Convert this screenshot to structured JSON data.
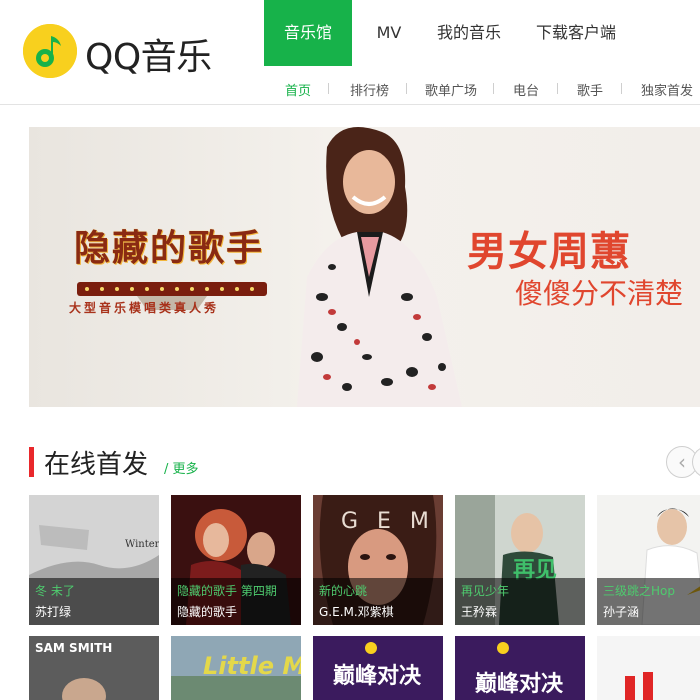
{
  "brand": {
    "name": "QQ音乐"
  },
  "topnav": [
    {
      "label": "音乐馆",
      "active": true
    },
    {
      "label": "MV"
    },
    {
      "label": "我的音乐"
    },
    {
      "label": "下载客户端"
    }
  ],
  "subnav": [
    {
      "label": "首页",
      "active": true
    },
    {
      "label": "排行榜"
    },
    {
      "label": "歌单广场"
    },
    {
      "label": "电台"
    },
    {
      "label": "歌手"
    },
    {
      "label": "独家首发"
    }
  ],
  "banner": {
    "show_logo": "隐藏的歌手",
    "show_sub": "大型音乐模唱类真人秀",
    "headline": "男女周蕙",
    "subline": "傻傻分不清楚"
  },
  "section": {
    "title": "在线首发",
    "more": "/ 更多"
  },
  "cards": [
    {
      "song": "冬 未了",
      "artist": "苏打绿",
      "art": "Winter Endless"
    },
    {
      "song": "隐藏的歌手 第四期",
      "artist": "隐藏的歌手"
    },
    {
      "song": "新的心跳",
      "artist": "G.E.M.邓紫棋",
      "art": "G E M"
    },
    {
      "song": "再见少年",
      "artist": "王矜霖"
    },
    {
      "song": "三级跳之Hop",
      "artist": "孙子涵"
    }
  ],
  "cards_row2": [
    {
      "art": "SAM SMITH"
    },
    {
      "art": "Little Mix"
    },
    {
      "art": "巅峰对决"
    },
    {
      "art": "巅峰对决"
    }
  ],
  "colors": {
    "accent": "#17b24a",
    "red": "#e9282b",
    "banner_text": "#e0462e"
  }
}
